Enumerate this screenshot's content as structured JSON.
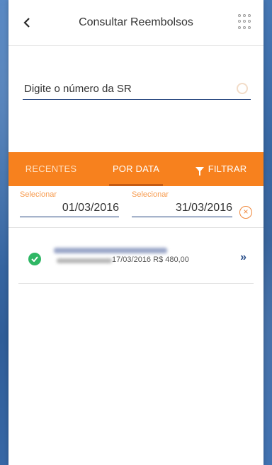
{
  "header": {
    "title": "Consultar Reembolsos"
  },
  "search": {
    "placeholder": "Digite o número da SR"
  },
  "tabs": [
    {
      "label": "RECENTES"
    },
    {
      "label": "POR DATA"
    },
    {
      "label": "FILTRAR"
    }
  ],
  "dates": {
    "start_label": "Selecionar",
    "start_value": "01/03/2016",
    "end_label": "Selecionar",
    "end_value": "31/03/2016"
  },
  "results": [
    {
      "date": "17/03/2016",
      "amount": "R$ 480,00",
      "status": "approved"
    }
  ],
  "colors": {
    "accent": "#f7811e",
    "nav": "#1e3f7a",
    "success": "#2fb765"
  }
}
